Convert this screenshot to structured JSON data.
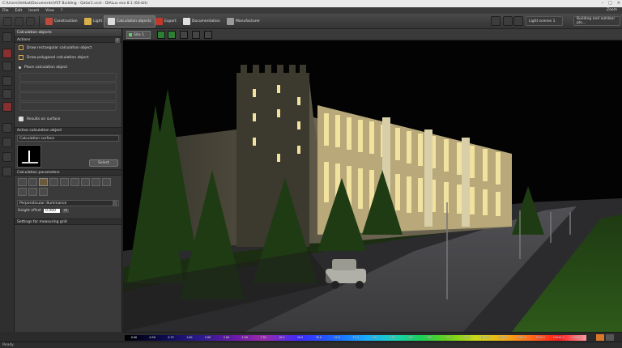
{
  "window": {
    "title": "C:\\Users\\Vetkat\\Documents\\VST Building - Qatar1.vcst - DIALux evo 8.1 (64-bit)"
  },
  "menu": [
    "File",
    "Edit",
    "Insert",
    "View",
    "?"
  ],
  "zoom_label": "Zoom",
  "toolbar": {
    "tabs": [
      {
        "label": "Construction",
        "active": false,
        "icon_color": "#c04a3a"
      },
      {
        "label": "Light",
        "active": false,
        "icon_color": "#d8b04a"
      },
      {
        "label": "Calculation objects",
        "active": true,
        "icon_color": "#e0e0e0"
      },
      {
        "label": "Export",
        "active": false,
        "icon_color": "#c0392b"
      },
      {
        "label": "Documentation",
        "active": false,
        "icon_color": "#e0e0e0"
      },
      {
        "label": "Manufacturer",
        "active": false,
        "icon_color": "#9a9a9a"
      }
    ],
    "light_scenes": "Light scenes 1",
    "building_select": "Building and outdoor plo..."
  },
  "panel": {
    "title": "Calculation objects",
    "actions_label": "Actions",
    "actions": [
      {
        "label": "Draw rectangular calculation object",
        "enabled": true
      },
      {
        "label": "Draw polygonal calculation object",
        "enabled": true
      },
      {
        "label": "Place calculation object",
        "enabled": true
      }
    ],
    "results_on_surface": "Results on surface",
    "active_section": "Active calculation object",
    "active_name": "Calculation surface",
    "select_button": "Select",
    "params_section": "Calculation parameters",
    "param_type": "Perpendicular illuminance",
    "height_offset_label": "Height offset",
    "height_offset_value": "0.000",
    "height_unit": "m",
    "grid_section": "Settings for measuring grid"
  },
  "viewport": {
    "site_label": "Site 1",
    "sky_color": "#050505"
  },
  "legend": {
    "values": [
      "0.00",
      "0.50",
      "0.75",
      "1.00",
      "2.00",
      "3.00",
      "5.00",
      "7.50",
      "10.0",
      "20.0",
      "30.0",
      "50.0",
      "75.0",
      "100",
      "150",
      "200",
      "300",
      "500",
      "750.0",
      "1000.0",
      "2000.0",
      "5000.0",
      "7500.0",
      "10000.0",
      "15000.0"
    ]
  },
  "status": {
    "text": "Ready"
  }
}
